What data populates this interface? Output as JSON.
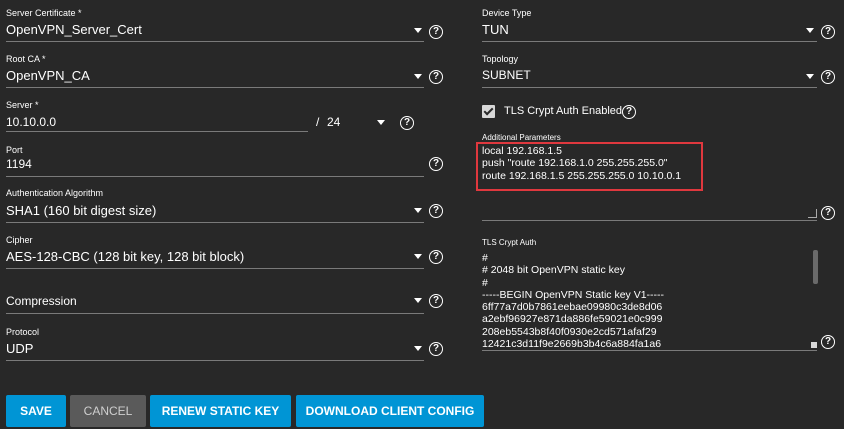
{
  "left": {
    "server_certificate": {
      "label": "Server Certificate *",
      "value": "OpenVPN_Server_Cert"
    },
    "root_ca": {
      "label": "Root CA *",
      "value": "OpenVPN_CA"
    },
    "server": {
      "label": "Server *",
      "value": "10.10.0.0",
      "separator": "/",
      "netmask": "24"
    },
    "port": {
      "label": "Port",
      "value": "1194"
    },
    "auth_algorithm": {
      "label": "Authentication Algorithm",
      "value": "SHA1 (160 bit digest size)"
    },
    "cipher": {
      "label": "Cipher",
      "value": "AES-128-CBC (128 bit key, 128 bit block)"
    },
    "compression": {
      "label": "Compression",
      "value": "Compression"
    },
    "protocol": {
      "label": "Protocol",
      "value": "UDP"
    }
  },
  "right": {
    "device_type": {
      "label": "Device Type",
      "value": "TUN"
    },
    "topology": {
      "label": "Topology",
      "value": "SUBNET"
    },
    "tls_crypt_auth_enabled": {
      "label": "TLS Crypt Auth Enabled",
      "checked": true
    },
    "additional_parameters": {
      "label": "Additional Parameters",
      "lines": [
        "local 192.168.1.5",
        "push \"route 192.168.1.0 255.255.255.0\"",
        "route 192.168.1.5 255.255.255.0 10.10.0.1"
      ]
    },
    "tls_crypt_auth": {
      "label": "TLS Crypt Auth",
      "lines": [
        "#",
        "# 2048 bit OpenVPN static key",
        "#",
        "-----BEGIN OpenVPN Static key V1-----",
        "6ff77a7d0b7861eebae09980c3de8d06",
        "a2ebf96927e871da886fe59021e0c999",
        "208eb5543b8f40f0930e2cd571afaf29",
        "12421c3d11f9e2669b3b4c6a884fa1a6"
      ]
    }
  },
  "help_glyph": "?",
  "buttons": {
    "save": "SAVE",
    "cancel": "CANCEL",
    "renew_static_key": "RENEW STATIC KEY",
    "download_client_config": "DOWNLOAD CLIENT CONFIG"
  },
  "colors": {
    "background": "#282828",
    "primary_button": "#0095d5",
    "cancel_button": "#5a5a5a",
    "highlight_box": "#e0383e"
  }
}
